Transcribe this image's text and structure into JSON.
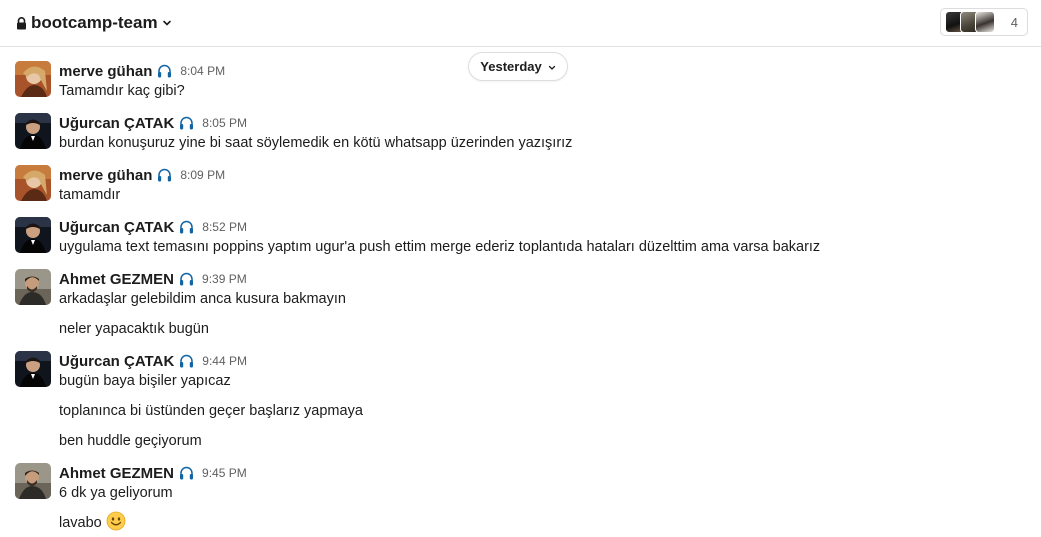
{
  "header": {
    "channel_name": "bootcamp-team",
    "member_count": "4"
  },
  "date_divider": {
    "label": "Yesterday"
  },
  "messages": [
    {
      "author": "merve gühan",
      "time": "8:04 PM",
      "lines": [
        "Tamamdır kaç gibi?"
      ]
    },
    {
      "author": "Uğurcan ÇATAK",
      "time": "8:05 PM",
      "lines": [
        "burdan konuşuruz yine bi saat söylemedik en kötü whatsapp üzerinden yazışırız"
      ]
    },
    {
      "author": "merve gühan",
      "time": "8:09 PM",
      "lines": [
        "tamamdır"
      ]
    },
    {
      "author": "Uğurcan ÇATAK",
      "time": "8:52 PM",
      "lines": [
        "uygulama text temasını poppins yaptım ugur'a push ettim merge ederiz toplantıda hataları düzelttim ama varsa bakarız"
      ]
    },
    {
      "author": "Ahmet GEZMEN",
      "time": "9:39 PM",
      "lines": [
        "arkadaşlar gelebildim anca kusura bakmayın",
        "neler yapacaktık bugün"
      ]
    },
    {
      "author": "Uğurcan ÇATAK",
      "time": "9:44 PM",
      "lines": [
        "bugün baya bişiler yapıcaz",
        "toplanınca bi üstünden geçer başlarız yapmaya",
        "ben huddle geçiyorum"
      ]
    },
    {
      "author": "Ahmet GEZMEN",
      "time": "9:45 PM",
      "lines": [
        "6 dk ya geliyorum",
        "lavabo"
      ]
    }
  ],
  "icons": {
    "lock": "lock-icon",
    "chevron": "chevron-down-icon",
    "headphones": "headphones-icon",
    "emoji": "slightly-smiling-face-emoji"
  },
  "colors": {
    "text": "#1d1c1d",
    "muted": "#616061",
    "headphones": "#1264a3",
    "border": "#dddddd"
  }
}
